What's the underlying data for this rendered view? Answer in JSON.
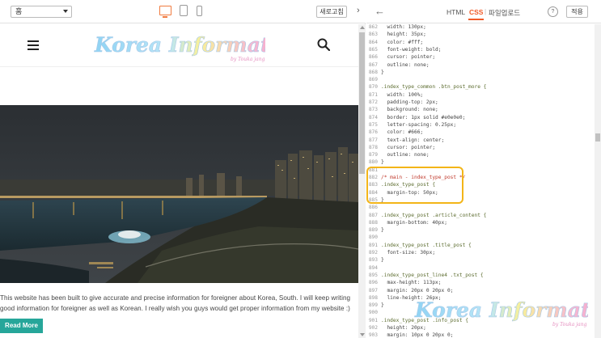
{
  "toolbar": {
    "page_select_value": "홈",
    "refresh_label": "새로고침",
    "expand_icon": "›"
  },
  "site": {
    "logo_text": "Korea Information",
    "logo_sub": "by Touka jang",
    "description": "This website has been built to give accurate and precise information for foreigner about Korea, South. I will keep writing good information for foreigner as well as Korean. I really wish you guys would get proper information from my website :)",
    "read_more": "Read More"
  },
  "editor": {
    "back_icon": "←",
    "tabs": [
      "HTML",
      "CSS",
      "파일업로드"
    ],
    "active_tab": "CSS",
    "separator": "|",
    "help_label": "?",
    "apply_label": "적용",
    "code_lines": [
      {
        "n": "862",
        "t": "  width: 130px;",
        "k": "prop"
      },
      {
        "n": "863",
        "t": "  height: 35px;",
        "k": "prop"
      },
      {
        "n": "864",
        "t": "  color: #fff;",
        "k": "prop"
      },
      {
        "n": "865",
        "t": "  font-weight: bold;",
        "k": "prop"
      },
      {
        "n": "866",
        "t": "  cursor: pointer;",
        "k": "prop"
      },
      {
        "n": "867",
        "t": "  outline: none;",
        "k": "prop"
      },
      {
        "n": "868",
        "t": "}",
        "k": "prop"
      },
      {
        "n": "869",
        "t": "",
        "k": "prop"
      },
      {
        "n": "870",
        "t": ".index_type_common .btn_post_more {",
        "k": "sel"
      },
      {
        "n": "871",
        "t": "  width: 100%;",
        "k": "prop"
      },
      {
        "n": "872",
        "t": "  padding-top: 2px;",
        "k": "prop"
      },
      {
        "n": "873",
        "t": "  background: none;",
        "k": "prop"
      },
      {
        "n": "874",
        "t": "  border: 1px solid #e0e0e0;",
        "k": "prop"
      },
      {
        "n": "875",
        "t": "  letter-spacing: 0.25px;",
        "k": "prop"
      },
      {
        "n": "876",
        "t": "  color: #666;",
        "k": "prop"
      },
      {
        "n": "877",
        "t": "  text-align: center;",
        "k": "prop"
      },
      {
        "n": "878",
        "t": "  cursor: pointer;",
        "k": "prop"
      },
      {
        "n": "879",
        "t": "  outline: none;",
        "k": "prop"
      },
      {
        "n": "880",
        "t": "}",
        "k": "prop"
      },
      {
        "n": "881",
        "t": "",
        "k": "prop"
      },
      {
        "n": "882",
        "t": "/* main - index_type_post */",
        "k": "cmt"
      },
      {
        "n": "883",
        "t": ".index_type_post {",
        "k": "sel"
      },
      {
        "n": "884",
        "t": "  margin-top: 50px;",
        "k": "prop"
      },
      {
        "n": "885",
        "t": "}",
        "k": "prop"
      },
      {
        "n": "886",
        "t": "",
        "k": "prop"
      },
      {
        "n": "887",
        "t": ".index_type_post .article_content {",
        "k": "sel"
      },
      {
        "n": "888",
        "t": "  margin-bottom: 40px;",
        "k": "prop"
      },
      {
        "n": "889",
        "t": "}",
        "k": "prop"
      },
      {
        "n": "890",
        "t": "",
        "k": "prop"
      },
      {
        "n": "891",
        "t": ".index_type_post .title_post {",
        "k": "sel"
      },
      {
        "n": "892",
        "t": "  font-size: 30px;",
        "k": "prop"
      },
      {
        "n": "893",
        "t": "}",
        "k": "prop"
      },
      {
        "n": "894",
        "t": "",
        "k": "prop"
      },
      {
        "n": "895",
        "t": ".index_type_post_line4 .txt_post {",
        "k": "sel"
      },
      {
        "n": "896",
        "t": "  max-height: 113px;",
        "k": "prop"
      },
      {
        "n": "897",
        "t": "  margin: 20px 0 20px 0;",
        "k": "prop"
      },
      {
        "n": "898",
        "t": "  line-height: 26px;",
        "k": "prop"
      },
      {
        "n": "899",
        "t": "}",
        "k": "prop"
      },
      {
        "n": "900",
        "t": "",
        "k": "prop"
      },
      {
        "n": "901",
        "t": ".index_type_post .info_post {",
        "k": "sel"
      },
      {
        "n": "902",
        "t": "  height: 20px;",
        "k": "prop"
      },
      {
        "n": "903",
        "t": "  margin: 10px 0 20px 0;",
        "k": "prop"
      }
    ]
  },
  "colors": {
    "accent": "#f05a28",
    "read_more_bg": "#26a69a",
    "highlight": "#f3b518"
  }
}
